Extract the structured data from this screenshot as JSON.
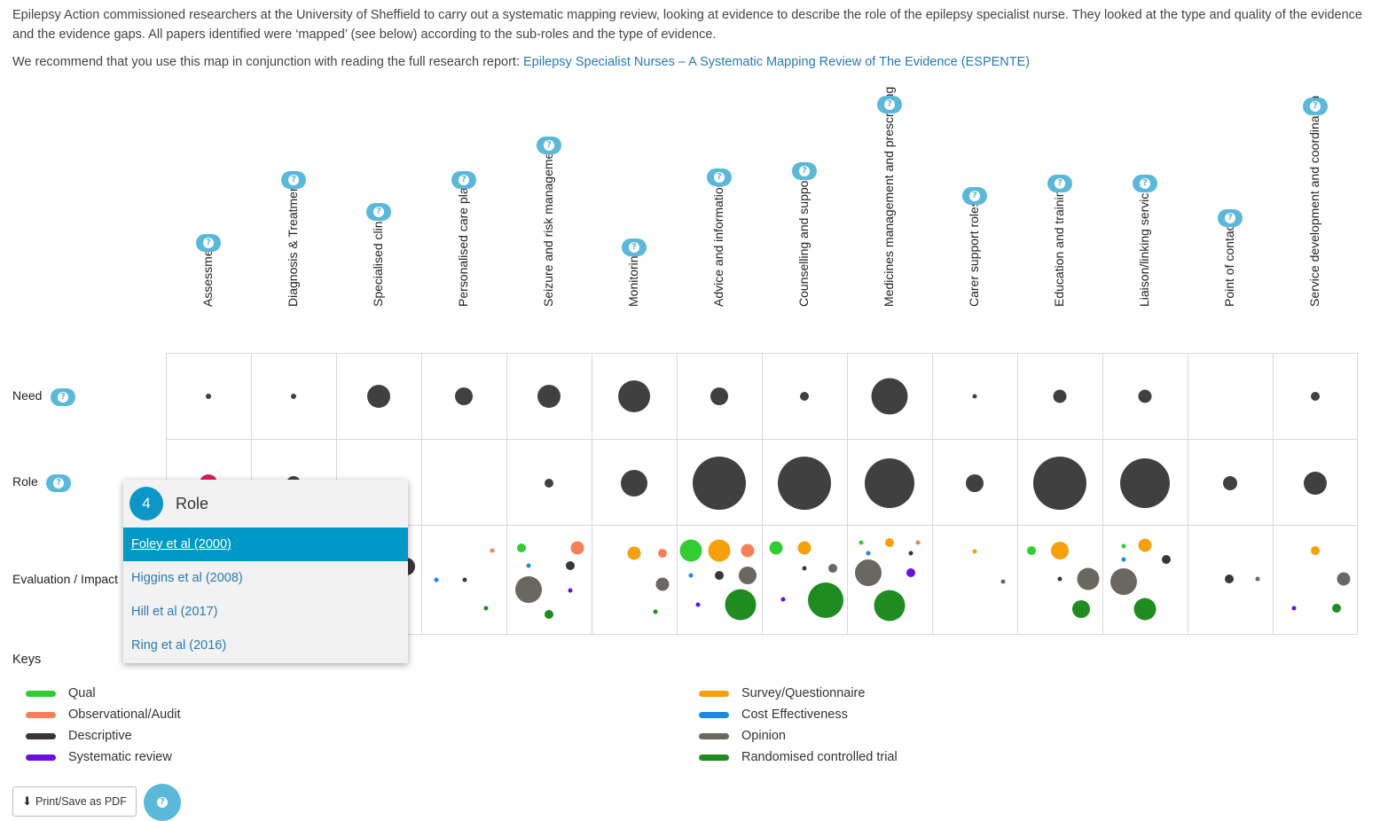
{
  "intro": {
    "p1": "Epilepsy Action commissioned researchers at the University of Sheffield to carry out a systematic mapping review, looking at evidence to describe the role of the epilepsy specialist nurse. They looked at the type and quality of the evidence and the evidence gaps. All papers identified were ‘mapped’ (see below) according to the sub-roles and the type of evidence.",
    "p2_prefix": "We recommend that you use this map in conjunction with reading the full research report: ",
    "p2_link": "Epilepsy Specialist Nurses – A Systematic Mapping Review of The Evidence (ESPENTE)"
  },
  "help_glyph": "?",
  "columns": [
    "Assessment",
    "Diagnosis & Treatment",
    "Specialised clinics",
    "Personalised care plans",
    "Seizure and risk management",
    "Monitoring",
    "Advice and information",
    "Counselling and support",
    "Medicines management and prescribing",
    "Carer support roles",
    "Education and training",
    "Liaison/linking services",
    "Point of contact",
    "Service development and coordination"
  ],
  "rows": {
    "need": "Need",
    "role": "Role",
    "evaluation": "Evaluation / Impact"
  },
  "colors": {
    "qual": "#33cc33",
    "observational": "#f47f5a",
    "descriptive": "#3d3535",
    "systematic": "#6a0fe0",
    "survey": "#f5a00c",
    "cost": "#1e88e5",
    "opinion": "#696760",
    "rct": "#1f8c21",
    "count_dark": "#404040",
    "assessment_role": "#d81b60"
  },
  "keys": {
    "title": "Keys",
    "left": [
      {
        "label": "Qual",
        "color": "#33cc33"
      },
      {
        "label": "Observational/Audit",
        "color": "#f47f5a"
      },
      {
        "label": "Descriptive",
        "color": "#3d3535"
      },
      {
        "label": "Systematic review",
        "color": "#6a0fe0"
      }
    ],
    "right": [
      {
        "label": "Survey/Questionnaire",
        "color": "#f5a00c"
      },
      {
        "label": "Cost Effectiveness",
        "color": "#1e88e5"
      },
      {
        "label": "Opinion",
        "color": "#696760"
      },
      {
        "label": "Randomised controlled trial",
        "color": "#1f8c21"
      }
    ]
  },
  "popup": {
    "count": "4",
    "title": "Role",
    "items": [
      "Foley et al (2000)",
      "Higgins et al (2008)",
      "Hill et al (2017)",
      "Ring et al (2016)"
    ]
  },
  "buttons": {
    "print": "Print/Save as PDF",
    "download_glyph": "⬇"
  }
}
